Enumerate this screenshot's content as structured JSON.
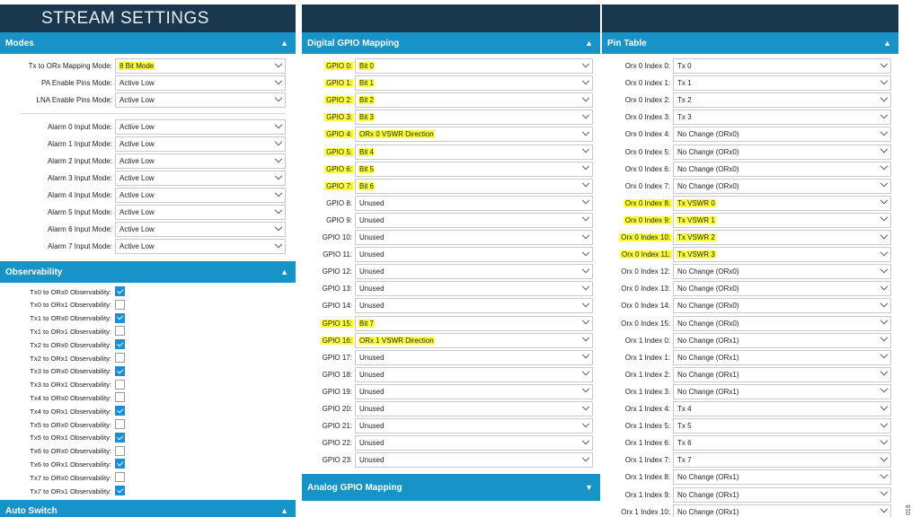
{
  "title": "STREAM SETTINGS",
  "side_tag": "019",
  "modes": {
    "header": "Modes",
    "rows": [
      {
        "label": "Tx to ORx Mapping Mode:",
        "value": "8 Bit Mode",
        "hl": true
      },
      {
        "label": "PA Enable Pins Mode:",
        "value": "Active Low"
      },
      {
        "label": "LNA Enable Pins Mode:",
        "value": "Active Low"
      },
      {
        "label": "Alarm 0 Input Mode:",
        "value": "Active Low"
      },
      {
        "label": "Alarm 1 Input Mode:",
        "value": "Active Low"
      },
      {
        "label": "Alarm 2 Input Mode:",
        "value": "Active Low"
      },
      {
        "label": "Alarm 3 Input Mode:",
        "value": "Active Low"
      },
      {
        "label": "Alarm 4 Input Mode:",
        "value": "Active Low"
      },
      {
        "label": "Alarm 5 Input Mode:",
        "value": "Active Low"
      },
      {
        "label": "Alarm 6 Input Mode:",
        "value": "Active Low"
      },
      {
        "label": "Alarm 7 Input Mode:",
        "value": "Active Low"
      }
    ]
  },
  "observability": {
    "header": "Observability",
    "rows": [
      {
        "label": "Tx0 to ORx0 Observability:",
        "checked": true
      },
      {
        "label": "Tx0 to ORx1 Observability:",
        "checked": false
      },
      {
        "label": "Tx1 to ORx0 Observability:",
        "checked": true
      },
      {
        "label": "Tx1 to ORx1 Observability:",
        "checked": false
      },
      {
        "label": "Tx2 to ORx0 Observability:",
        "checked": true
      },
      {
        "label": "Tx2 to ORx1 Observability:",
        "checked": false
      },
      {
        "label": "Tx3 to ORx0 Observability:",
        "checked": true
      },
      {
        "label": "Tx3 to ORx1 Observability:",
        "checked": false
      },
      {
        "label": "Tx4 to ORx0 Observability:",
        "checked": false
      },
      {
        "label": "Tx4 to ORx1 Observability:",
        "checked": true
      },
      {
        "label": "Tx5 to ORx0 Observability:",
        "checked": false
      },
      {
        "label": "Tx5 to ORx1 Observability:",
        "checked": true
      },
      {
        "label": "Tx6 to ORx0 Observability:",
        "checked": false
      },
      {
        "label": "Tx6 to ORx1 Observability:",
        "checked": true
      },
      {
        "label": "Tx7 to ORx0 Observability:",
        "checked": false
      },
      {
        "label": "Tx7 to ORx1 Observability:",
        "checked": true
      }
    ]
  },
  "auto_switch": {
    "header": "Auto Switch"
  },
  "gpio": {
    "header": "Digital GPIO Mapping",
    "rows": [
      {
        "label": "GPIO 0:",
        "value": "Bit 0",
        "hl": true
      },
      {
        "label": "GPIO 1:",
        "value": "Bit 1",
        "hl": true
      },
      {
        "label": "GPIO 2:",
        "value": "Bit 2",
        "hl": true
      },
      {
        "label": "GPIO 3:",
        "value": "Bit 3",
        "hl": true
      },
      {
        "label": "GPIO 4:",
        "value": "ORx 0 VSWR Direction",
        "hl": true
      },
      {
        "label": "GPIO 5:",
        "value": "Bit 4",
        "hl": true
      },
      {
        "label": "GPIO 6:",
        "value": "Bit 5",
        "hl": true
      },
      {
        "label": "GPIO 7:",
        "value": "Bit 6",
        "hl": true
      },
      {
        "label": "GPIO 8:",
        "value": "Unused"
      },
      {
        "label": "GPIO 9:",
        "value": "Unused"
      },
      {
        "label": "GPIO 10:",
        "value": "Unused"
      },
      {
        "label": "GPIO 11:",
        "value": "Unused"
      },
      {
        "label": "GPIO 12:",
        "value": "Unused"
      },
      {
        "label": "GPIO 13:",
        "value": "Unused"
      },
      {
        "label": "GPIO 14:",
        "value": "Unused"
      },
      {
        "label": "GPIO 15:",
        "value": "Bit 7",
        "hl": true
      },
      {
        "label": "GPIO 16:",
        "value": "ORx 1 VSWR Direction",
        "hl": true
      },
      {
        "label": "GPIO 17:",
        "value": "Unused"
      },
      {
        "label": "GPIO 18:",
        "value": "Unused"
      },
      {
        "label": "GPIO 19:",
        "value": "Unused"
      },
      {
        "label": "GPIO 20:",
        "value": "Unused"
      },
      {
        "label": "GPIO 21:",
        "value": "Unused"
      },
      {
        "label": "GPIO 22:",
        "value": "Unused"
      },
      {
        "label": "GPIO 23:",
        "value": "Unused"
      }
    ]
  },
  "analog": {
    "header": "Analog GPIO Mapping"
  },
  "pins": {
    "header": "Pin Table",
    "rows": [
      {
        "label": "Orx 0 Index 0:",
        "value": "Tx 0"
      },
      {
        "label": "Orx 0 Index 1:",
        "value": "Tx 1"
      },
      {
        "label": "Orx 0 Index 2:",
        "value": "Tx 2"
      },
      {
        "label": "Orx 0 Index 3:",
        "value": "Tx 3"
      },
      {
        "label": "Orx 0 Index 4:",
        "value": "No Change (ORx0)"
      },
      {
        "label": "Orx 0 Index 5:",
        "value": "No Change (ORx0)"
      },
      {
        "label": "Orx 0 Index 6:",
        "value": "No Change (ORx0)"
      },
      {
        "label": "Orx 0 Index 7:",
        "value": "No Change (ORx0)"
      },
      {
        "label": "Orx 0 Index 8:",
        "value": "Tx VSWR 0",
        "hl": true
      },
      {
        "label": "Orx 0 Index 9:",
        "value": "Tx VSWR 1",
        "hl": true
      },
      {
        "label": "Orx 0 Index 10:",
        "value": "Tx VSWR 2",
        "hl": true
      },
      {
        "label": "Orx 0 Index 11:",
        "value": "Tx VSWR 3",
        "hl": true
      },
      {
        "label": "Orx 0 Index 12:",
        "value": "No Change (ORx0)"
      },
      {
        "label": "Orx 0 Index 13:",
        "value": "No Change (ORx0)"
      },
      {
        "label": "Orx 0 Index 14:",
        "value": "No Change (ORx0)"
      },
      {
        "label": "Orx 0 Index 15:",
        "value": "No Change (ORx0)"
      },
      {
        "label": "Orx 1 Index 0:",
        "value": "No Change (ORx1)"
      },
      {
        "label": "Orx 1 Index 1:",
        "value": "No Change (ORx1)"
      },
      {
        "label": "Orx 1 Index 2:",
        "value": "No Change (ORx1)"
      },
      {
        "label": "Orx 1 Index 3:",
        "value": "No Change (ORx1)"
      },
      {
        "label": "Orx 1 Index 4:",
        "value": "Tx 4"
      },
      {
        "label": "Orx 1 Index 5:",
        "value": "Tx 5"
      },
      {
        "label": "Orx 1 Index 6:",
        "value": "Tx 6"
      },
      {
        "label": "Orx 1 Index 7:",
        "value": "Tx 7"
      },
      {
        "label": "Orx 1 Index 8:",
        "value": "No Change (ORx1)"
      },
      {
        "label": "Orx 1 Index 9:",
        "value": "No Change (ORx1)"
      },
      {
        "label": "Orx 1 Index 10:",
        "value": "No Change (ORx1)"
      }
    ]
  },
  "colors": {
    "header_dark": "#19384e",
    "section_blue": "#1893c8",
    "highlight": "#ffff3b",
    "check_blue": "#1a8fd6"
  }
}
